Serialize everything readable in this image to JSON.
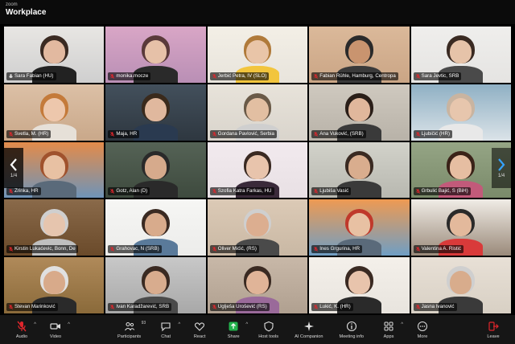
{
  "app": {
    "zoom_label": "zoom",
    "title": "Workplace"
  },
  "participants": [
    {
      "name": "Sara Fabian (HU)",
      "muted": false,
      "active": true
    },
    {
      "name": "monika.mocze",
      "muted": true
    },
    {
      "name": "Jerbić Petra, IV (SLO)",
      "muted": true
    },
    {
      "name": "Fabian Rühle, Hamburg, Centropa",
      "muted": true
    },
    {
      "name": "Sara Jevtic, SRB",
      "muted": true
    },
    {
      "name": "Svetla, M. (HR)",
      "muted": true
    },
    {
      "name": "Maja, HR",
      "muted": true
    },
    {
      "name": "Gordana Pavlović, Serbia",
      "muted": true
    },
    {
      "name": "Ana Vuković, (SRB)",
      "muted": true
    },
    {
      "name": "Ljubičić (HR)",
      "muted": true
    },
    {
      "name": "Zrinka, HR",
      "muted": true
    },
    {
      "name": "Gotz, Alan (D)",
      "muted": true
    },
    {
      "name": "Szofia Katra Farkas, HU",
      "muted": true
    },
    {
      "name": "Ljubiša Vasić",
      "muted": true
    },
    {
      "name": "Grbulić Bajić, S (BiH)",
      "muted": true
    },
    {
      "name": "Kirstin Lukaćevic, Bonn, De",
      "muted": true
    },
    {
      "name": "Grahovac, N (SRB)",
      "muted": true
    },
    {
      "name": "Oliver Mićić, (RS)",
      "muted": true
    },
    {
      "name": "Ines Grgurina, HR",
      "muted": true
    },
    {
      "name": "Valentina A. Ristić",
      "muted": true
    },
    {
      "name": "Stevan Marinković",
      "muted": true
    },
    {
      "name": "Ivan Karadžarević, SRB",
      "muted": true
    },
    {
      "name": "Uglješa Urošević (RS)",
      "muted": true
    },
    {
      "name": "Lukić, K. (HR)",
      "muted": true
    },
    {
      "name": "Jasna Ivanović",
      "muted": true
    }
  ],
  "navigation": {
    "left_page": "1/4",
    "right_page": "1/4"
  },
  "toolbar": {
    "audio": "Audio",
    "video": "Video",
    "participants": "Participants",
    "participants_count": "93",
    "chat": "Chat",
    "react": "React",
    "share": "Share",
    "host_tools": "Host tools",
    "ai_companion": "AI Companion",
    "meeting_info": "Meeting info",
    "apps": "Apps",
    "more": "More",
    "leave": "Leave"
  },
  "colors": {
    "mute_red": "#e0262c",
    "active_speaker": "#2ecc40",
    "share_green": "#22b24c",
    "leave_red": "#e0262c"
  }
}
